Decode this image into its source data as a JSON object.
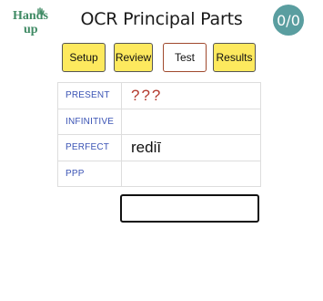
{
  "logo": {
    "line1": "Hands",
    "line2": "up"
  },
  "header": {
    "title": "OCR Principal Parts",
    "score": "0/0"
  },
  "nav": {
    "setup": "Setup",
    "review": "Review",
    "test": "Test",
    "results": "Results"
  },
  "table": {
    "rows": [
      {
        "label": "PRESENT",
        "value": "???"
      },
      {
        "label": "INFINITIVE",
        "value": ""
      },
      {
        "label": "PERFECT",
        "value": "rediī"
      },
      {
        "label": "PPP",
        "value": ""
      }
    ]
  },
  "answer": {
    "value": "",
    "placeholder": ""
  },
  "colors": {
    "score_bg": "#5a9ea0",
    "button_yellow": "#fde95e",
    "label_blue": "#3b54b5",
    "prompt_red": "#b33a2e",
    "logo_green": "#3f8a64"
  }
}
